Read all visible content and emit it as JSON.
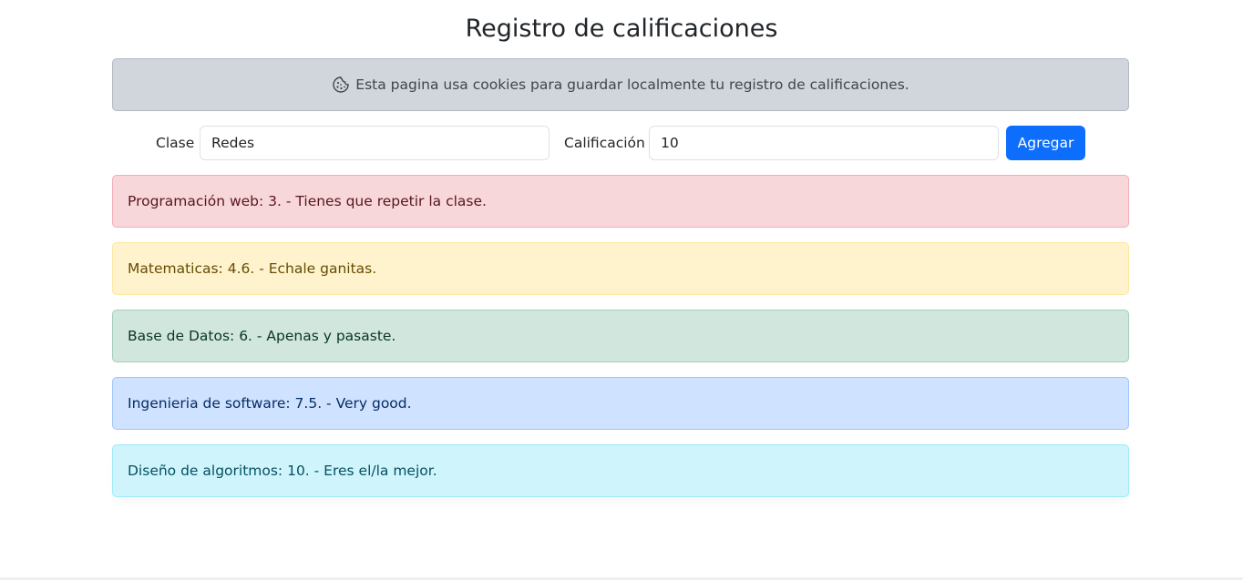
{
  "page": {
    "title": "Registro de calificaciones"
  },
  "cookie_notice": {
    "icon": "cookie-icon",
    "text": "Esta pagina usa cookies para guardar localmente tu registro de calificaciones."
  },
  "form": {
    "clase_label": "Clase",
    "clase_value": "Redes",
    "calificacion_label": "Calificación",
    "calificacion_value": "10",
    "add_button_label": "Agregar"
  },
  "grades": [
    {
      "text": "Programación web: 3. - Tienes que repetir la clase.",
      "status": "danger",
      "color": "#f8d7da"
    },
    {
      "text": "Matematicas: 4.6. - Echale ganitas.",
      "status": "warning",
      "color": "#fff3cd"
    },
    {
      "text": "Base de Datos: 6. - Apenas y pasaste.",
      "status": "success",
      "color": "#d1e7dd"
    },
    {
      "text": "Ingenieria de software: 7.5. - Very good.",
      "status": "primary",
      "color": "#cfe2ff"
    },
    {
      "text": "Diseño de algoritmos: 10. - Eres el/la mejor.",
      "status": "info",
      "color": "#cff4fc"
    }
  ],
  "colors": {
    "accent": "#0d6efd",
    "notice_bg": "#d1d5dc"
  }
}
